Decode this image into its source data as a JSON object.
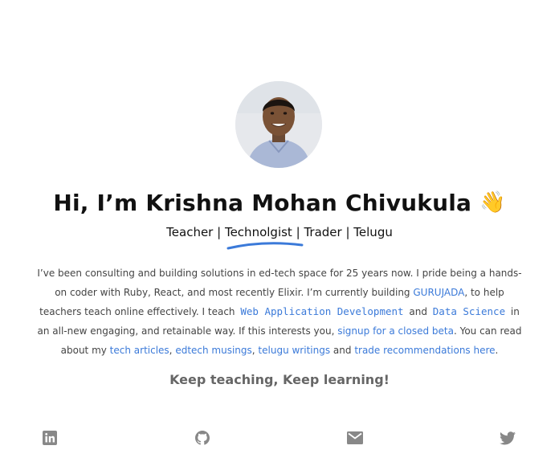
{
  "profile": {
    "greeting": "Hi, I’m Krishna Mohan Chivukula",
    "wave_emoji": "👋"
  },
  "roles": {
    "teacher": "Teacher",
    "technologist": "Technolgist",
    "trader": "Trader",
    "telugu": "Telugu",
    "separator": "|"
  },
  "bio": {
    "p1": "I’ve been consulting and building solutions in ed-tech space for 25 years now. I pride being a hands-on coder with Ruby, React, and most recently Elixir. I’m currently building ",
    "gurujada_link": "GURUJADA",
    "p2": ", to help teachers teach online effectively. I teach ",
    "course_web": "Web Application Development",
    "p3": " and ",
    "course_ds": "Data Science",
    "p4": " in an all-new engaging, and retainable way. If this interests you, ",
    "beta_link": "signup for a closed beta",
    "p5": ". You can read about my ",
    "tech_link": "tech articles",
    "sep1": ", ",
    "edtech_link": "edtech musings",
    "sep2": ", ",
    "telugu_link": "telugu writings",
    "p6": " and ",
    "trade_link": "trade recommendations here",
    "p7": "."
  },
  "tagline": "Keep teaching, Keep learning!",
  "social": {
    "icons": [
      "linkedin-icon",
      "github-icon",
      "mail-icon",
      "twitter-icon"
    ],
    "icon_color": "#888888"
  },
  "colors": {
    "link": "#3b7ad9",
    "underline": "#3b7ad9"
  }
}
